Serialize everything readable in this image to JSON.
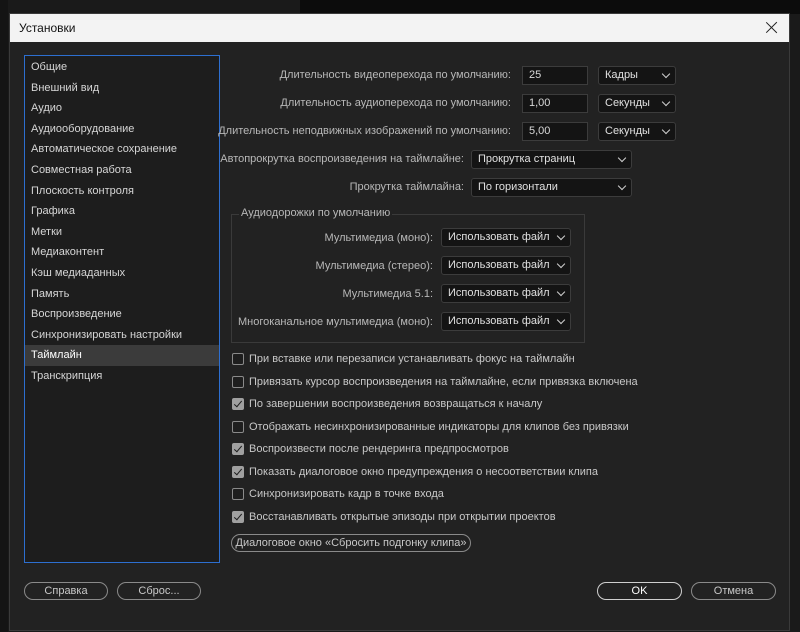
{
  "window": {
    "title": "Установки"
  },
  "sidebar": {
    "items": [
      "Общие",
      "Внешний вид",
      "Аудио",
      "Аудиооборудование",
      "Автоматическое сохранение",
      "Совместная работа",
      "Плоскость контроля",
      "Графика",
      "Метки",
      "Медиаконтент",
      "Кэш медиаданных",
      "Память",
      "Воспроизведение",
      "Синхронизировать настройки",
      "Таймлайн",
      "Транскрипция"
    ],
    "selected": "Таймлайн"
  },
  "durations": [
    {
      "label": "Длительность видеоперехода по умолчанию:",
      "value": "25",
      "unit": "Кадры"
    },
    {
      "label": "Длительность аудиоперехода по умолчанию:",
      "value": "1,00",
      "unit": "Секунды"
    },
    {
      "label": "Длительность неподвижных изображений по умолчанию:",
      "value": "5,00",
      "unit": "Секунды"
    }
  ],
  "autoscroll": {
    "label": "Автопрокрутка воспроизведения на таймлайне:",
    "value": "Прокрутка страниц"
  },
  "timeline_scroll": {
    "label": "Прокрутка таймлайна:",
    "value": "По горизонтали"
  },
  "audio_tracks": {
    "title": "Аудиодорожки по умолчанию",
    "rows": [
      {
        "label": "Мультимедиа (моно):",
        "value": "Использовать файл"
      },
      {
        "label": "Мультимедиа (стерео):",
        "value": "Использовать файл"
      },
      {
        "label": "Мультимедиа 5.1:",
        "value": "Использовать файл"
      },
      {
        "label": "Многоканальное мультимедиа (моно):",
        "value": "Использовать файл"
      }
    ]
  },
  "options": [
    {
      "label": "При вставке или перезаписи устанавливать фокус на таймлайн",
      "checked": false
    },
    {
      "label": "Привязать курсор воспроизведения на таймлайне, если привязка включена",
      "checked": false
    },
    {
      "label": "По завершении воспроизведения возвращаться к началу",
      "checked": true
    },
    {
      "label": "Отображать несинхронизированные индикаторы для клипов без привязки",
      "checked": false
    },
    {
      "label": "Воспроизвести после рендеринга предпросмотров",
      "checked": true
    },
    {
      "label": "Показать диалоговое окно предупреждения о несоответствии клипа",
      "checked": true
    },
    {
      "label": "Синхронизировать кадр в точке входа",
      "checked": false
    },
    {
      "label": "Восстанавливать открытые эпизоды при открытии проектов",
      "checked": true
    }
  ],
  "reset_clip_dialog_button": "Диалоговое окно «Сбросить подгонку клипа»",
  "footer": {
    "help": "Справка",
    "reset": "Сброс...",
    "ok": "OK",
    "cancel": "Отмена"
  }
}
